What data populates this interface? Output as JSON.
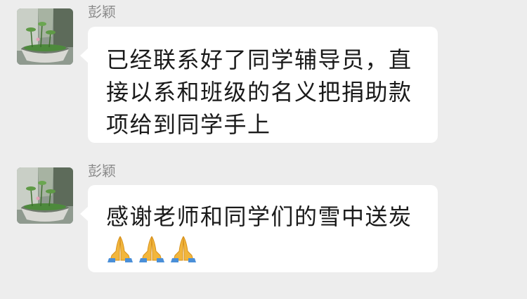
{
  "messages": [
    {
      "sender": "彭颖",
      "text": "已经联系好了同学辅导员，直接以系和班级的名义把捐助款项给到同学手上",
      "emojis": []
    },
    {
      "sender": "彭颖",
      "text": "感谢老师和同学们的雪中送炭",
      "emojis": [
        "folded-hands-icon",
        "folded-hands-icon",
        "folded-hands-icon"
      ]
    }
  ],
  "colors": {
    "background": "#ededed",
    "bubble": "#ffffff",
    "sender_name": "#8a8a8a",
    "message_text": "#1a1a1a"
  }
}
